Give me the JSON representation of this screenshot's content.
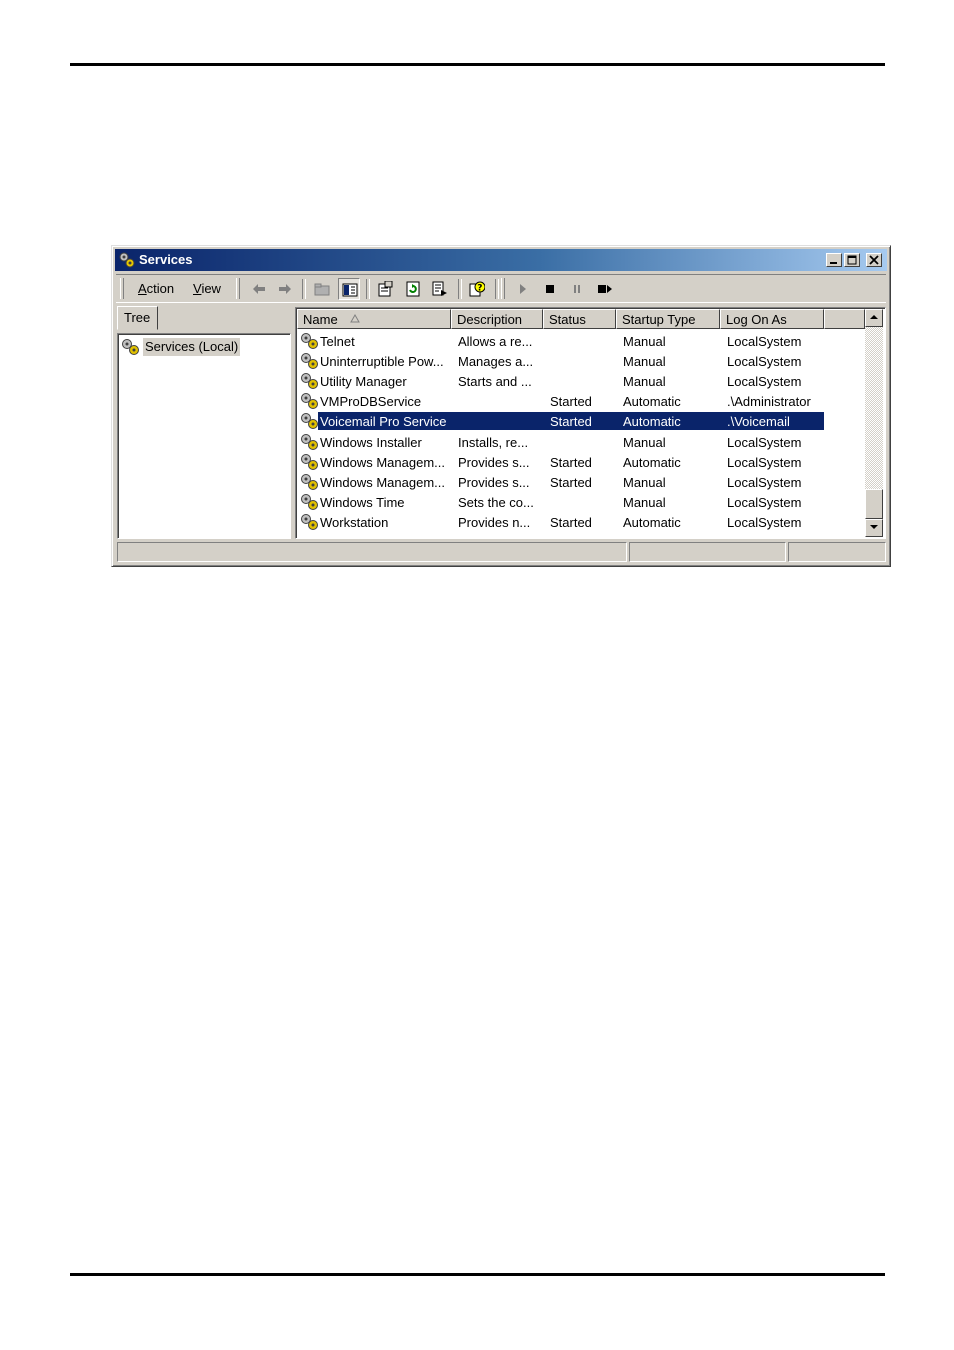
{
  "window": {
    "title": "Services",
    "controls": [
      "minimize-icon",
      "maximize-icon",
      "close-icon"
    ]
  },
  "menu": {
    "action_prefix": "",
    "action_accel": "A",
    "action_rest": "ction",
    "view_accel": "V",
    "view_rest": "iew"
  },
  "toolbar": {
    "icons": [
      "back-arrow-icon",
      "forward-arrow-icon",
      "up-folder-icon",
      "show-hide-tree-icon",
      "properties-icon",
      "refresh-icon",
      "export-list-icon",
      "help-icon",
      "start-service-icon",
      "stop-service-icon",
      "pause-service-icon",
      "restart-service-icon"
    ]
  },
  "tree": {
    "tab_label": "Tree",
    "root_label": "Services (Local)"
  },
  "list": {
    "columns": [
      "Name",
      "Description",
      "Status",
      "Startup Type",
      "Log On As"
    ],
    "sort_column": "Name",
    "selected_index": 4,
    "rows": [
      {
        "name": "Telnet",
        "description": "Allows a re...",
        "status": "",
        "startup": "Manual",
        "logon": "LocalSystem"
      },
      {
        "name": "Uninterruptible Pow...",
        "description": "Manages a...",
        "status": "",
        "startup": "Manual",
        "logon": "LocalSystem"
      },
      {
        "name": "Utility Manager",
        "description": "Starts and ...",
        "status": "",
        "startup": "Manual",
        "logon": "LocalSystem"
      },
      {
        "name": "VMProDBService",
        "description": "",
        "status": "Started",
        "startup": "Automatic",
        "logon": ".\\Administrator"
      },
      {
        "name": "Voicemail Pro Service",
        "description": "",
        "status": "Started",
        "startup": "Automatic",
        "logon": ".\\Voicemail"
      },
      {
        "name": "Windows Installer",
        "description": "Installs, re...",
        "status": "",
        "startup": "Manual",
        "logon": "LocalSystem"
      },
      {
        "name": "Windows Managem...",
        "description": "Provides s...",
        "status": "Started",
        "startup": "Automatic",
        "logon": "LocalSystem"
      },
      {
        "name": "Windows Managem...",
        "description": "Provides s...",
        "status": "Started",
        "startup": "Manual",
        "logon": "LocalSystem"
      },
      {
        "name": "Windows Time",
        "description": "Sets the co...",
        "status": "",
        "startup": "Manual",
        "logon": "LocalSystem"
      },
      {
        "name": "Workstation",
        "description": "Provides n...",
        "status": "Started",
        "startup": "Automatic",
        "logon": "LocalSystem"
      }
    ]
  },
  "colors": {
    "title_gradient_start": "#0a246a",
    "title_gradient_end": "#a6caf0",
    "selection": "#0a246a",
    "chrome": "#d4d0c8"
  }
}
